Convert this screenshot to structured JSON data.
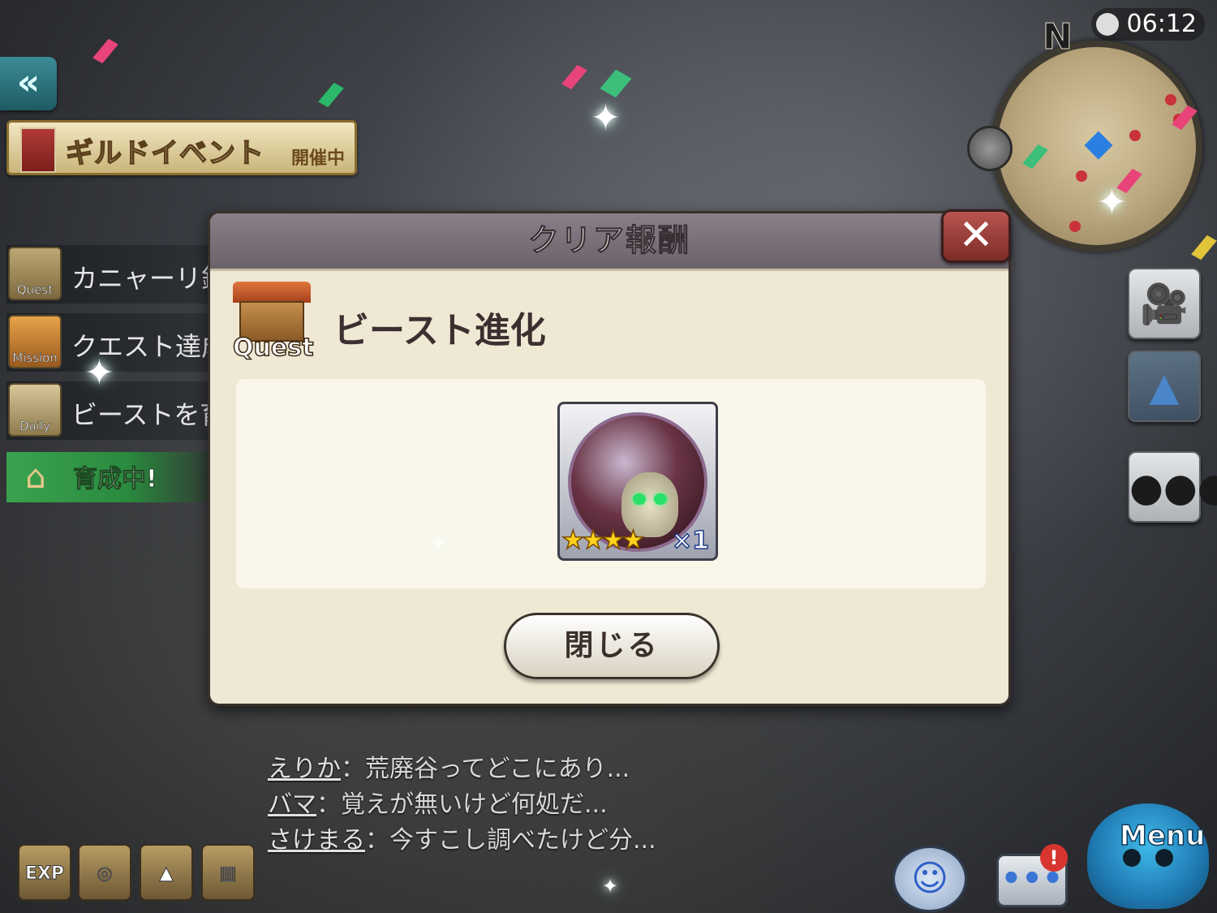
{
  "hud": {
    "clock": "06:12",
    "compass_north": "N",
    "back_symbol": "«"
  },
  "guild_event": {
    "title": "ギルドイベント",
    "status": "開催中"
  },
  "side_list": [
    {
      "icon_label": "Quest",
      "text": "カニャーリ鉱",
      "icon": "quest-icon"
    },
    {
      "icon_label": "Mission",
      "text": "クエスト達成",
      "icon": "mission-icon"
    },
    {
      "icon_label": "Daily",
      "text": "ビーストを育",
      "icon": "daily-icon"
    }
  ],
  "growing": {
    "text": "育成中!"
  },
  "dialog": {
    "title": "クリア報酬",
    "close_symbol": "✕",
    "quest_icon_label": "Quest",
    "mission_name": "ビースト進化",
    "reward": {
      "quantity": "×1",
      "stars": "★★★★",
      "star_rating": 4
    },
    "close_button": "閉じる"
  },
  "chat": [
    {
      "name": "えりか",
      "message": "：荒廃谷ってどこにあり..."
    },
    {
      "name": "バマ",
      "message": "：覚えが無いけど何処だ..."
    },
    {
      "name": "さけまる",
      "message": "：今すこし調べたけど分..."
    }
  ],
  "bottom_buttons": [
    {
      "label": "EXP",
      "icon": "exp-boost-icon"
    },
    {
      "label": "",
      "icon": "gold-boost-icon"
    },
    {
      "label": "",
      "icon": "drop-boost-icon"
    },
    {
      "label": "",
      "icon": "cage-icon"
    }
  ],
  "menu": {
    "label": "Menu",
    "chat_alert": "!"
  },
  "right_buttons": [
    {
      "icon": "camera-icon"
    },
    {
      "icon": "auto-icon"
    },
    {
      "icon": "party-icon"
    }
  ]
}
